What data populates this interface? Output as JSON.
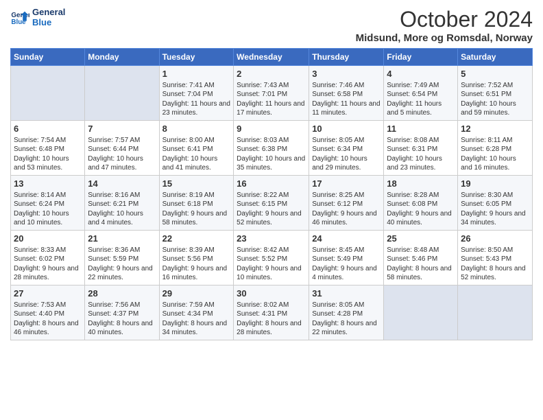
{
  "header": {
    "logo_line1": "General",
    "logo_line2": "Blue",
    "title": "October 2024",
    "subtitle": "Midsund, More og Romsdal, Norway"
  },
  "columns": [
    "Sunday",
    "Monday",
    "Tuesday",
    "Wednesday",
    "Thursday",
    "Friday",
    "Saturday"
  ],
  "weeks": [
    [
      {
        "day": "",
        "empty": true
      },
      {
        "day": "",
        "empty": true
      },
      {
        "day": "1",
        "sunrise": "Sunrise: 7:41 AM",
        "sunset": "Sunset: 7:04 PM",
        "daylight": "Daylight: 11 hours and 23 minutes."
      },
      {
        "day": "2",
        "sunrise": "Sunrise: 7:43 AM",
        "sunset": "Sunset: 7:01 PM",
        "daylight": "Daylight: 11 hours and 17 minutes."
      },
      {
        "day": "3",
        "sunrise": "Sunrise: 7:46 AM",
        "sunset": "Sunset: 6:58 PM",
        "daylight": "Daylight: 11 hours and 11 minutes."
      },
      {
        "day": "4",
        "sunrise": "Sunrise: 7:49 AM",
        "sunset": "Sunset: 6:54 PM",
        "daylight": "Daylight: 11 hours and 5 minutes."
      },
      {
        "day": "5",
        "sunrise": "Sunrise: 7:52 AM",
        "sunset": "Sunset: 6:51 PM",
        "daylight": "Daylight: 10 hours and 59 minutes."
      }
    ],
    [
      {
        "day": "6",
        "sunrise": "Sunrise: 7:54 AM",
        "sunset": "Sunset: 6:48 PM",
        "daylight": "Daylight: 10 hours and 53 minutes."
      },
      {
        "day": "7",
        "sunrise": "Sunrise: 7:57 AM",
        "sunset": "Sunset: 6:44 PM",
        "daylight": "Daylight: 10 hours and 47 minutes."
      },
      {
        "day": "8",
        "sunrise": "Sunrise: 8:00 AM",
        "sunset": "Sunset: 6:41 PM",
        "daylight": "Daylight: 10 hours and 41 minutes."
      },
      {
        "day": "9",
        "sunrise": "Sunrise: 8:03 AM",
        "sunset": "Sunset: 6:38 PM",
        "daylight": "Daylight: 10 hours and 35 minutes."
      },
      {
        "day": "10",
        "sunrise": "Sunrise: 8:05 AM",
        "sunset": "Sunset: 6:34 PM",
        "daylight": "Daylight: 10 hours and 29 minutes."
      },
      {
        "day": "11",
        "sunrise": "Sunrise: 8:08 AM",
        "sunset": "Sunset: 6:31 PM",
        "daylight": "Daylight: 10 hours and 23 minutes."
      },
      {
        "day": "12",
        "sunrise": "Sunrise: 8:11 AM",
        "sunset": "Sunset: 6:28 PM",
        "daylight": "Daylight: 10 hours and 16 minutes."
      }
    ],
    [
      {
        "day": "13",
        "sunrise": "Sunrise: 8:14 AM",
        "sunset": "Sunset: 6:24 PM",
        "daylight": "Daylight: 10 hours and 10 minutes."
      },
      {
        "day": "14",
        "sunrise": "Sunrise: 8:16 AM",
        "sunset": "Sunset: 6:21 PM",
        "daylight": "Daylight: 10 hours and 4 minutes."
      },
      {
        "day": "15",
        "sunrise": "Sunrise: 8:19 AM",
        "sunset": "Sunset: 6:18 PM",
        "daylight": "Daylight: 9 hours and 58 minutes."
      },
      {
        "day": "16",
        "sunrise": "Sunrise: 8:22 AM",
        "sunset": "Sunset: 6:15 PM",
        "daylight": "Daylight: 9 hours and 52 minutes."
      },
      {
        "day": "17",
        "sunrise": "Sunrise: 8:25 AM",
        "sunset": "Sunset: 6:12 PM",
        "daylight": "Daylight: 9 hours and 46 minutes."
      },
      {
        "day": "18",
        "sunrise": "Sunrise: 8:28 AM",
        "sunset": "Sunset: 6:08 PM",
        "daylight": "Daylight: 9 hours and 40 minutes."
      },
      {
        "day": "19",
        "sunrise": "Sunrise: 8:30 AM",
        "sunset": "Sunset: 6:05 PM",
        "daylight": "Daylight: 9 hours and 34 minutes."
      }
    ],
    [
      {
        "day": "20",
        "sunrise": "Sunrise: 8:33 AM",
        "sunset": "Sunset: 6:02 PM",
        "daylight": "Daylight: 9 hours and 28 minutes."
      },
      {
        "day": "21",
        "sunrise": "Sunrise: 8:36 AM",
        "sunset": "Sunset: 5:59 PM",
        "daylight": "Daylight: 9 hours and 22 minutes."
      },
      {
        "day": "22",
        "sunrise": "Sunrise: 8:39 AM",
        "sunset": "Sunset: 5:56 PM",
        "daylight": "Daylight: 9 hours and 16 minutes."
      },
      {
        "day": "23",
        "sunrise": "Sunrise: 8:42 AM",
        "sunset": "Sunset: 5:52 PM",
        "daylight": "Daylight: 9 hours and 10 minutes."
      },
      {
        "day": "24",
        "sunrise": "Sunrise: 8:45 AM",
        "sunset": "Sunset: 5:49 PM",
        "daylight": "Daylight: 9 hours and 4 minutes."
      },
      {
        "day": "25",
        "sunrise": "Sunrise: 8:48 AM",
        "sunset": "Sunset: 5:46 PM",
        "daylight": "Daylight: 8 hours and 58 minutes."
      },
      {
        "day": "26",
        "sunrise": "Sunrise: 8:50 AM",
        "sunset": "Sunset: 5:43 PM",
        "daylight": "Daylight: 8 hours and 52 minutes."
      }
    ],
    [
      {
        "day": "27",
        "sunrise": "Sunrise: 7:53 AM",
        "sunset": "Sunset: 4:40 PM",
        "daylight": "Daylight: 8 hours and 46 minutes."
      },
      {
        "day": "28",
        "sunrise": "Sunrise: 7:56 AM",
        "sunset": "Sunset: 4:37 PM",
        "daylight": "Daylight: 8 hours and 40 minutes."
      },
      {
        "day": "29",
        "sunrise": "Sunrise: 7:59 AM",
        "sunset": "Sunset: 4:34 PM",
        "daylight": "Daylight: 8 hours and 34 minutes."
      },
      {
        "day": "30",
        "sunrise": "Sunrise: 8:02 AM",
        "sunset": "Sunset: 4:31 PM",
        "daylight": "Daylight: 8 hours and 28 minutes."
      },
      {
        "day": "31",
        "sunrise": "Sunrise: 8:05 AM",
        "sunset": "Sunset: 4:28 PM",
        "daylight": "Daylight: 8 hours and 22 minutes."
      },
      {
        "day": "",
        "empty": true
      },
      {
        "day": "",
        "empty": true
      }
    ]
  ]
}
